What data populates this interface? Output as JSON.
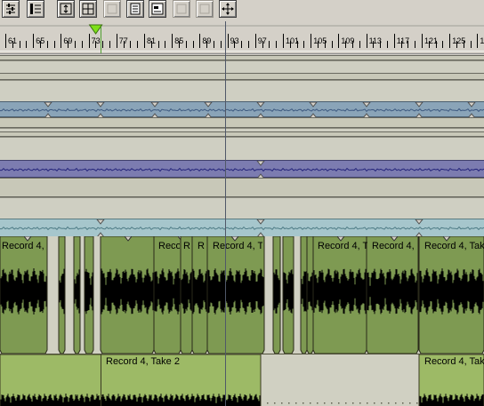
{
  "toolbar": {
    "buttons": [
      {
        "icon": "mixer-icon",
        "enabled": true
      },
      {
        "icon": "track-list-icon",
        "enabled": true
      },
      {
        "icon": "fit-vertical-icon",
        "enabled": true
      },
      {
        "icon": "grid-view-icon",
        "enabled": true
      },
      {
        "icon": "blank-icon",
        "enabled": false
      },
      {
        "icon": "page-icon",
        "enabled": true
      },
      {
        "icon": "clip-view-icon",
        "enabled": true
      },
      {
        "icon": "blank-icon",
        "enabled": false
      },
      {
        "icon": "blank-icon",
        "enabled": false
      },
      {
        "icon": "move-icon",
        "enabled": true
      }
    ]
  },
  "ruler": {
    "labels": [
      "61",
      "65",
      "69",
      "73",
      "77",
      "81",
      "85",
      "89",
      "93",
      "97",
      "101",
      "105",
      "109",
      "113",
      "117",
      "121",
      "125",
      "129"
    ],
    "playhead_marker": "73"
  },
  "clips": {
    "top_row": [
      {
        "label": "Record 4, T"
      },
      {
        "label": "Reco"
      },
      {
        "label": "R"
      },
      {
        "label": "R"
      },
      {
        "label": "Record 4, T"
      },
      {
        "label": "Record 4, T"
      },
      {
        "label": "Record 4, T"
      },
      {
        "label": "Record 4, Take"
      }
    ],
    "bottom_row": [
      {
        "label": "Record 4, Take 2"
      },
      {
        "label": "Record 4, Take"
      }
    ]
  },
  "colors": {
    "clip_dark": "#7e9a52",
    "clip_light": "#9dba66",
    "waveform": "#000000",
    "playhead": "#7ee01a"
  }
}
